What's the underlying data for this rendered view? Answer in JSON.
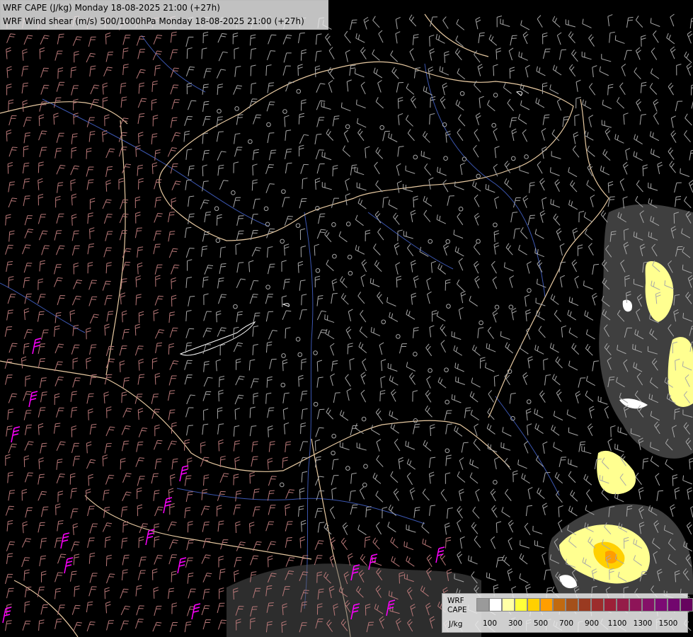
{
  "title": {
    "line1": "WRF CAPE (J/kg) Monday 18-08-2025 21:00 (+27h)",
    "line2": "WRF Wind shear (m/s) 500/1000hPa Monday 18-08-2025 21:00 (+27h)"
  },
  "legend": {
    "name_line1": "WRF",
    "name_line2": "CAPE",
    "unit": "J/kg",
    "colors": [
      "#9a9a9a",
      "#ffffff",
      "#ffffa6",
      "#ffff3a",
      "#ffd000",
      "#ff9e00",
      "#c16a10",
      "#a4501a",
      "#9a3a20",
      "#9c2c2c",
      "#9c2038",
      "#951c48",
      "#8e1458",
      "#851068",
      "#7c0a74",
      "#72066e",
      "#66045e"
    ],
    "tick_labels": [
      "100",
      "300",
      "500",
      "700",
      "900",
      "1100",
      "1300",
      "1500"
    ]
  },
  "colors": {
    "background": "#000000",
    "country_border": "#e6c8a0",
    "county_border": "#8a7a6a",
    "river": "#4060c0",
    "barb_gray": "#a8a8a8",
    "barb_pink": "#b87878",
    "barb_magenta": "#ff00ff",
    "cape_yellow": "#ffff80",
    "cape_orange": "#ffa000"
  }
}
